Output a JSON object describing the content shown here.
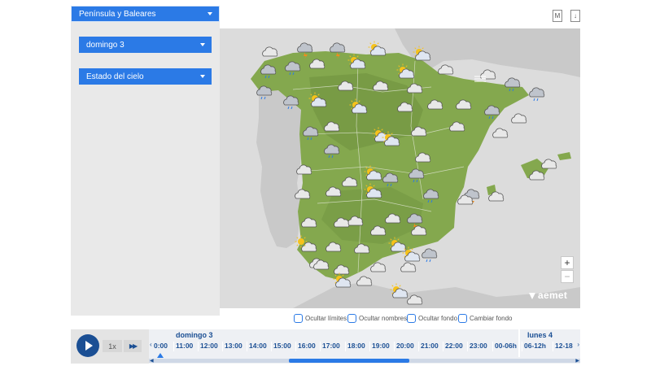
{
  "filters": {
    "region": "Península y Baleares",
    "day": "domingo 3",
    "layer": "Estado del cielo"
  },
  "tools": {
    "m_label": "M",
    "download_label": "↓"
  },
  "map": {
    "zoom_in": "+",
    "zoom_out": "−",
    "logo_text": "aemet",
    "sea_color": "#dcdcdc",
    "land_color": "#84a84e",
    "foreign_land_color": "#c9c9c9",
    "icons": [
      {
        "type": "cloud"
      },
      {
        "type": "storm"
      },
      {
        "type": "storm"
      },
      {
        "type": "sun-cloud"
      },
      {
        "type": "sun-cloud"
      },
      {
        "type": "rain"
      },
      {
        "type": "rain"
      },
      {
        "type": "sun-cloud"
      },
      {
        "type": "cloud"
      },
      {
        "type": "cloud"
      },
      {
        "type": "sun-cloud"
      },
      {
        "type": "cloud"
      },
      {
        "type": "rain"
      },
      {
        "type": "cloud"
      },
      {
        "type": "cloud"
      },
      {
        "type": "cloud"
      },
      {
        "type": "fog"
      },
      {
        "type": "rain"
      },
      {
        "type": "rain"
      },
      {
        "type": "rain"
      },
      {
        "type": "sun-cloud"
      },
      {
        "type": "sun-cloud"
      },
      {
        "type": "cloud"
      },
      {
        "type": "cloud"
      },
      {
        "type": "cloud"
      },
      {
        "type": "rain"
      },
      {
        "type": "cloud"
      },
      {
        "type": "cloud"
      },
      {
        "type": "rain"
      },
      {
        "type": "cloud"
      },
      {
        "type": "sun-cloud"
      },
      {
        "type": "cloud"
      },
      {
        "type": "cloud"
      },
      {
        "type": "rain"
      },
      {
        "type": "sun-cloud"
      },
      {
        "type": "cloud"
      },
      {
        "type": "sun-cloud"
      },
      {
        "type": "rain"
      },
      {
        "type": "rain"
      },
      {
        "type": "cloud"
      },
      {
        "type": "cloud"
      },
      {
        "type": "rain"
      },
      {
        "type": "storm"
      },
      {
        "type": "cloud"
      },
      {
        "type": "cloud"
      },
      {
        "type": "cloud"
      },
      {
        "type": "cloud"
      },
      {
        "type": "sun-cloud"
      },
      {
        "type": "cloud"
      },
      {
        "type": "cloud"
      },
      {
        "type": "storm"
      },
      {
        "type": "cloud"
      },
      {
        "type": "cloud"
      },
      {
        "type": "cloud"
      },
      {
        "type": "cloud"
      },
      {
        "type": "cloud"
      },
      {
        "type": "sun-cloud"
      },
      {
        "type": "cloud"
      },
      {
        "type": "cloud"
      },
      {
        "type": "cloud"
      },
      {
        "type": "cloud"
      },
      {
        "type": "cloud"
      },
      {
        "type": "sun-cloud"
      },
      {
        "type": "sun"
      },
      {
        "type": "cloud"
      },
      {
        "type": "cloud"
      },
      {
        "type": "cloud"
      },
      {
        "type": "rain"
      },
      {
        "type": "sun-cloud"
      },
      {
        "type": "cloud"
      },
      {
        "type": "cloud"
      },
      {
        "type": "sun-cloud"
      },
      {
        "type": "cloud"
      }
    ]
  },
  "options": {
    "hide_limits": "Ocultar límites",
    "hide_names": "Ocultar nombres",
    "hide_background": "Ocultar fondo",
    "change_background": "Cambiar fondo"
  },
  "player": {
    "speed": "1x",
    "ffwd": "▶▶",
    "days": [
      "domingo 3",
      "lunes 4"
    ],
    "hours": [
      "0:00",
      "11:00",
      "12:00",
      "13:00",
      "14:00",
      "15:00",
      "16:00",
      "17:00",
      "18:00",
      "19:00",
      "20:00",
      "21:00",
      "22:00",
      "23:00",
      "00-06h",
      "06-12h",
      "12-18"
    ],
    "arrow_left": "‹",
    "arrow_right": "›",
    "accent_color": "#2b7ae6",
    "dark_color": "#1b4f94"
  }
}
